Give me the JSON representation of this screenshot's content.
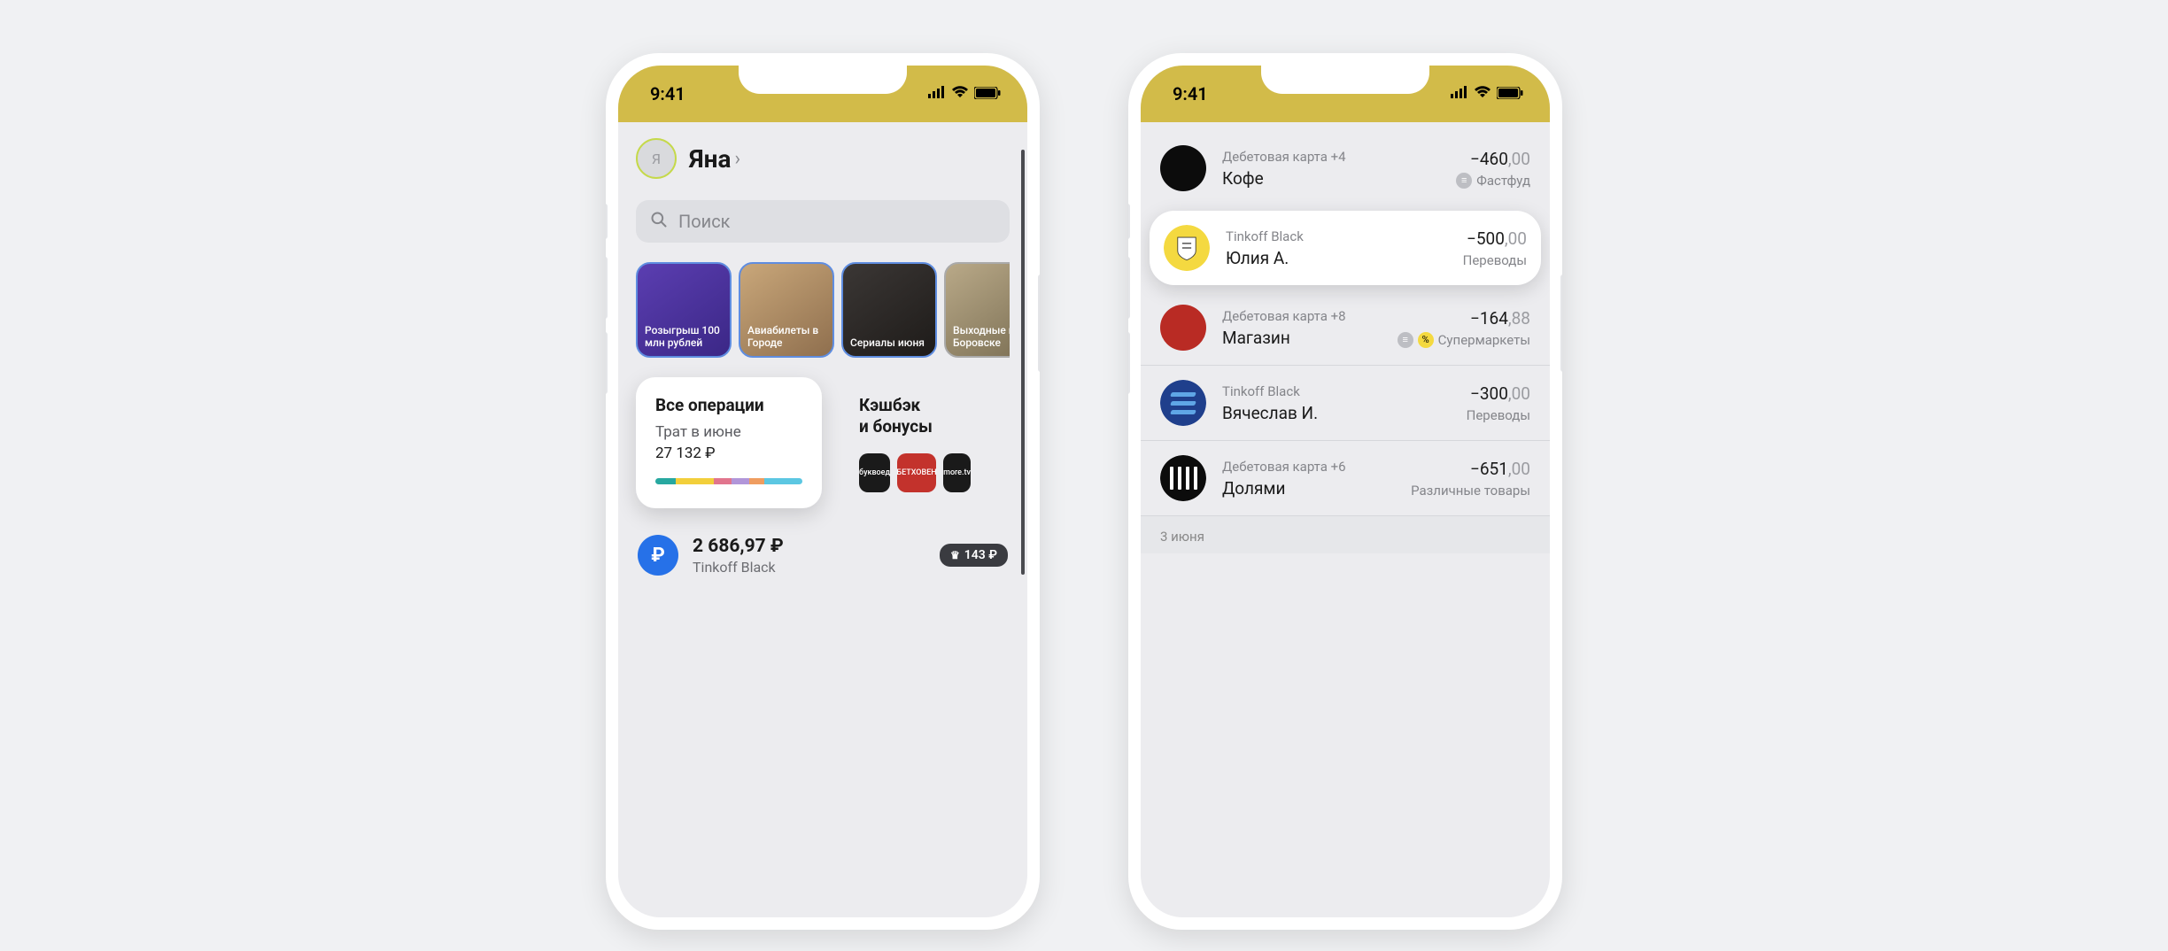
{
  "status": {
    "time": "9:41"
  },
  "home": {
    "avatar_initial": "Я",
    "name": "Яна",
    "search_placeholder": "Поиск",
    "stories": [
      {
        "label": "Розыгрыш 100 млн рублей"
      },
      {
        "label": "Авиабилеты в Городе"
      },
      {
        "label": "Сериалы июня"
      },
      {
        "label": "Выходные в Боровске"
      }
    ],
    "ops_widget": {
      "title": "Все операции",
      "subtitle": "Трат в июне",
      "amount": "27 132 ₽",
      "segments": [
        {
          "color": "#27a8a0",
          "w": 14
        },
        {
          "color": "#f2cf3b",
          "w": 26
        },
        {
          "color": "#e1758d",
          "w": 12
        },
        {
          "color": "#b196d9",
          "w": 12
        },
        {
          "color": "#ef9d60",
          "w": 10
        },
        {
          "color": "#5cc7e2",
          "w": 26
        }
      ]
    },
    "cashback_widget": {
      "title_l1": "Кэшбэк",
      "title_l2": "и бонусы",
      "brands": [
        "буквоед",
        "БЕТХОВЕН",
        "more.tv"
      ]
    },
    "account": {
      "balance": "2 686,97 ₽",
      "name": "Tinkoff Black",
      "badge": "143 ₽"
    }
  },
  "tx": {
    "items": [
      {
        "card": "Дебетовая карта",
        "extra": "+4",
        "merchant": "Кофе",
        "amount_int": "−460",
        "amount_dec": ",00",
        "category": "Фастфуд",
        "icons": [
          "receipt"
        ],
        "avatar": "black"
      },
      {
        "card": "Tinkoff Black",
        "extra": "",
        "merchant": "Юлия А.",
        "amount_int": "−500",
        "amount_dec": ",00",
        "category": "Переводы",
        "icons": [],
        "avatar": "tinkoff",
        "highlight": true
      },
      {
        "card": "Дебетовая карта",
        "extra": "+8",
        "merchant": "Магазин",
        "amount_int": "−164",
        "amount_dec": ",88",
        "category": "Супермаркеты",
        "icons": [
          "receipt",
          "percent"
        ],
        "avatar": "red"
      },
      {
        "card": "Tinkoff Black",
        "extra": "",
        "merchant": "Вячеслав И.",
        "amount_int": "−300",
        "amount_dec": ",00",
        "category": "Переводы",
        "icons": [],
        "avatar": "stripes"
      },
      {
        "card": "Дебетовая карта",
        "extra": "+6",
        "merchant": "Долями",
        "amount_int": "−651",
        "amount_dec": ",00",
        "category": "Различные товары",
        "icons": [],
        "avatar": "bars"
      }
    ],
    "date_header": "3 июня"
  }
}
